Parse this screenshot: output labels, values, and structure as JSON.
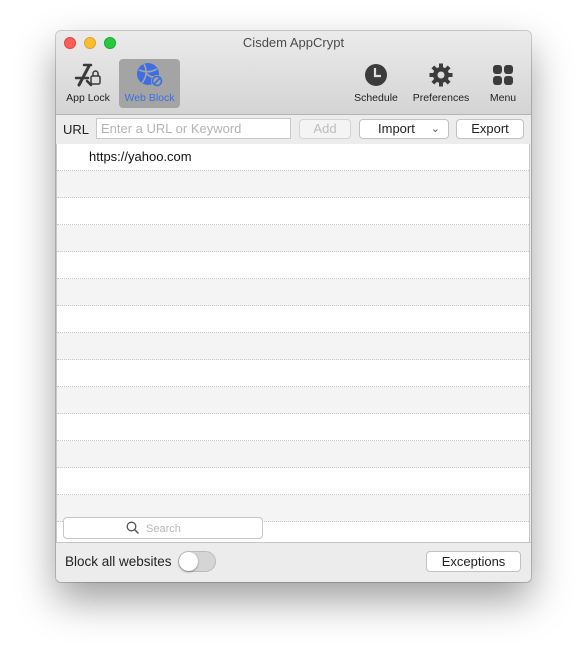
{
  "window": {
    "title": "Cisdem AppCrypt"
  },
  "toolbar": {
    "items": [
      {
        "label": "App Lock",
        "icon": "app-lock-icon",
        "selected": false
      },
      {
        "label": "Web Block",
        "icon": "web-block-icon",
        "selected": true
      },
      {
        "label": "Schedule",
        "icon": "clock-icon",
        "selected": false
      },
      {
        "label": "Preferences",
        "icon": "gear-icon",
        "selected": false
      },
      {
        "label": "Menu",
        "icon": "grid-icon",
        "selected": false
      }
    ],
    "accent_color": "#3d6fe0"
  },
  "urlbar": {
    "label": "URL",
    "input_value": "",
    "input_placeholder": "Enter a URL or Keyword",
    "add_label": "Add",
    "import_label": "Import",
    "export_label": "Export"
  },
  "list": {
    "rows": [
      "https://yahoo.com",
      "",
      "",
      "",
      "",
      "",
      "",
      "",
      "",
      "",
      "",
      "",
      "",
      "",
      ""
    ]
  },
  "search": {
    "placeholder": "Search",
    "value": ""
  },
  "footer": {
    "block_all_label": "Block all websites",
    "block_all_on": false,
    "exceptions_label": "Exceptions"
  }
}
